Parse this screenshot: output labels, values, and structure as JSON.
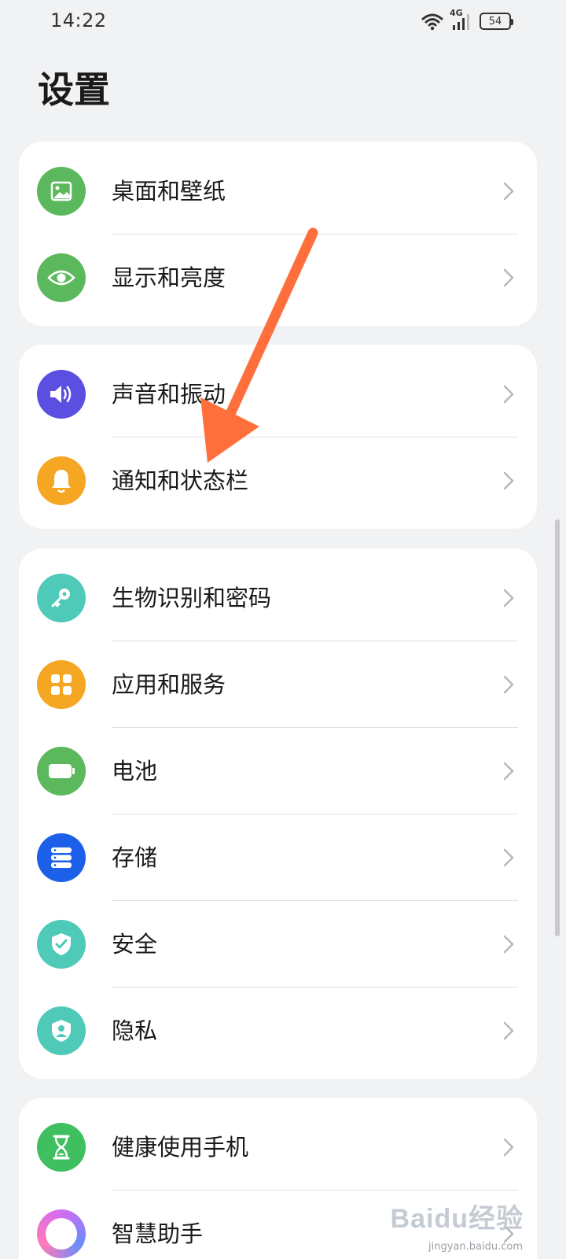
{
  "status_bar": {
    "time": "14:22",
    "network": "4G",
    "battery": "54"
  },
  "page": {
    "title": "设置"
  },
  "groups": [
    {
      "items": [
        {
          "label": "桌面和壁纸",
          "icon": "wallpaper-icon",
          "color": "#5cb85c"
        },
        {
          "label": "显示和亮度",
          "icon": "eye-icon",
          "color": "#5cb85c"
        }
      ]
    },
    {
      "items": [
        {
          "label": "声音和振动",
          "icon": "speaker-icon",
          "color": "#5a4fe0"
        },
        {
          "label": "通知和状态栏",
          "icon": "bell-icon",
          "color": "#f5a623"
        }
      ]
    },
    {
      "items": [
        {
          "label": "生物识别和密码",
          "icon": "key-icon",
          "color": "#4fc9b8"
        },
        {
          "label": "应用和服务",
          "icon": "apps-grid-icon",
          "color": "#f5a623"
        },
        {
          "label": "电池",
          "icon": "battery-icon",
          "color": "#5cb85c"
        },
        {
          "label": "存储",
          "icon": "storage-icon",
          "color": "#1c5fe8"
        },
        {
          "label": "安全",
          "icon": "shield-check-icon",
          "color": "#4fc9b8"
        },
        {
          "label": "隐私",
          "icon": "privacy-shield-icon",
          "color": "#4fc9b8"
        }
      ]
    },
    {
      "items": [
        {
          "label": "健康使用手机",
          "icon": "hourglass-icon",
          "color": "#3fbf5f"
        },
        {
          "label": "智慧助手",
          "icon": "assistant-icon",
          "color": "#d46cf0"
        }
      ]
    }
  ],
  "watermark": {
    "brand": "Baidu经验",
    "url": "jingyan.baidu.com"
  },
  "colors": {
    "annotation_arrow": "#ff6f3c"
  }
}
